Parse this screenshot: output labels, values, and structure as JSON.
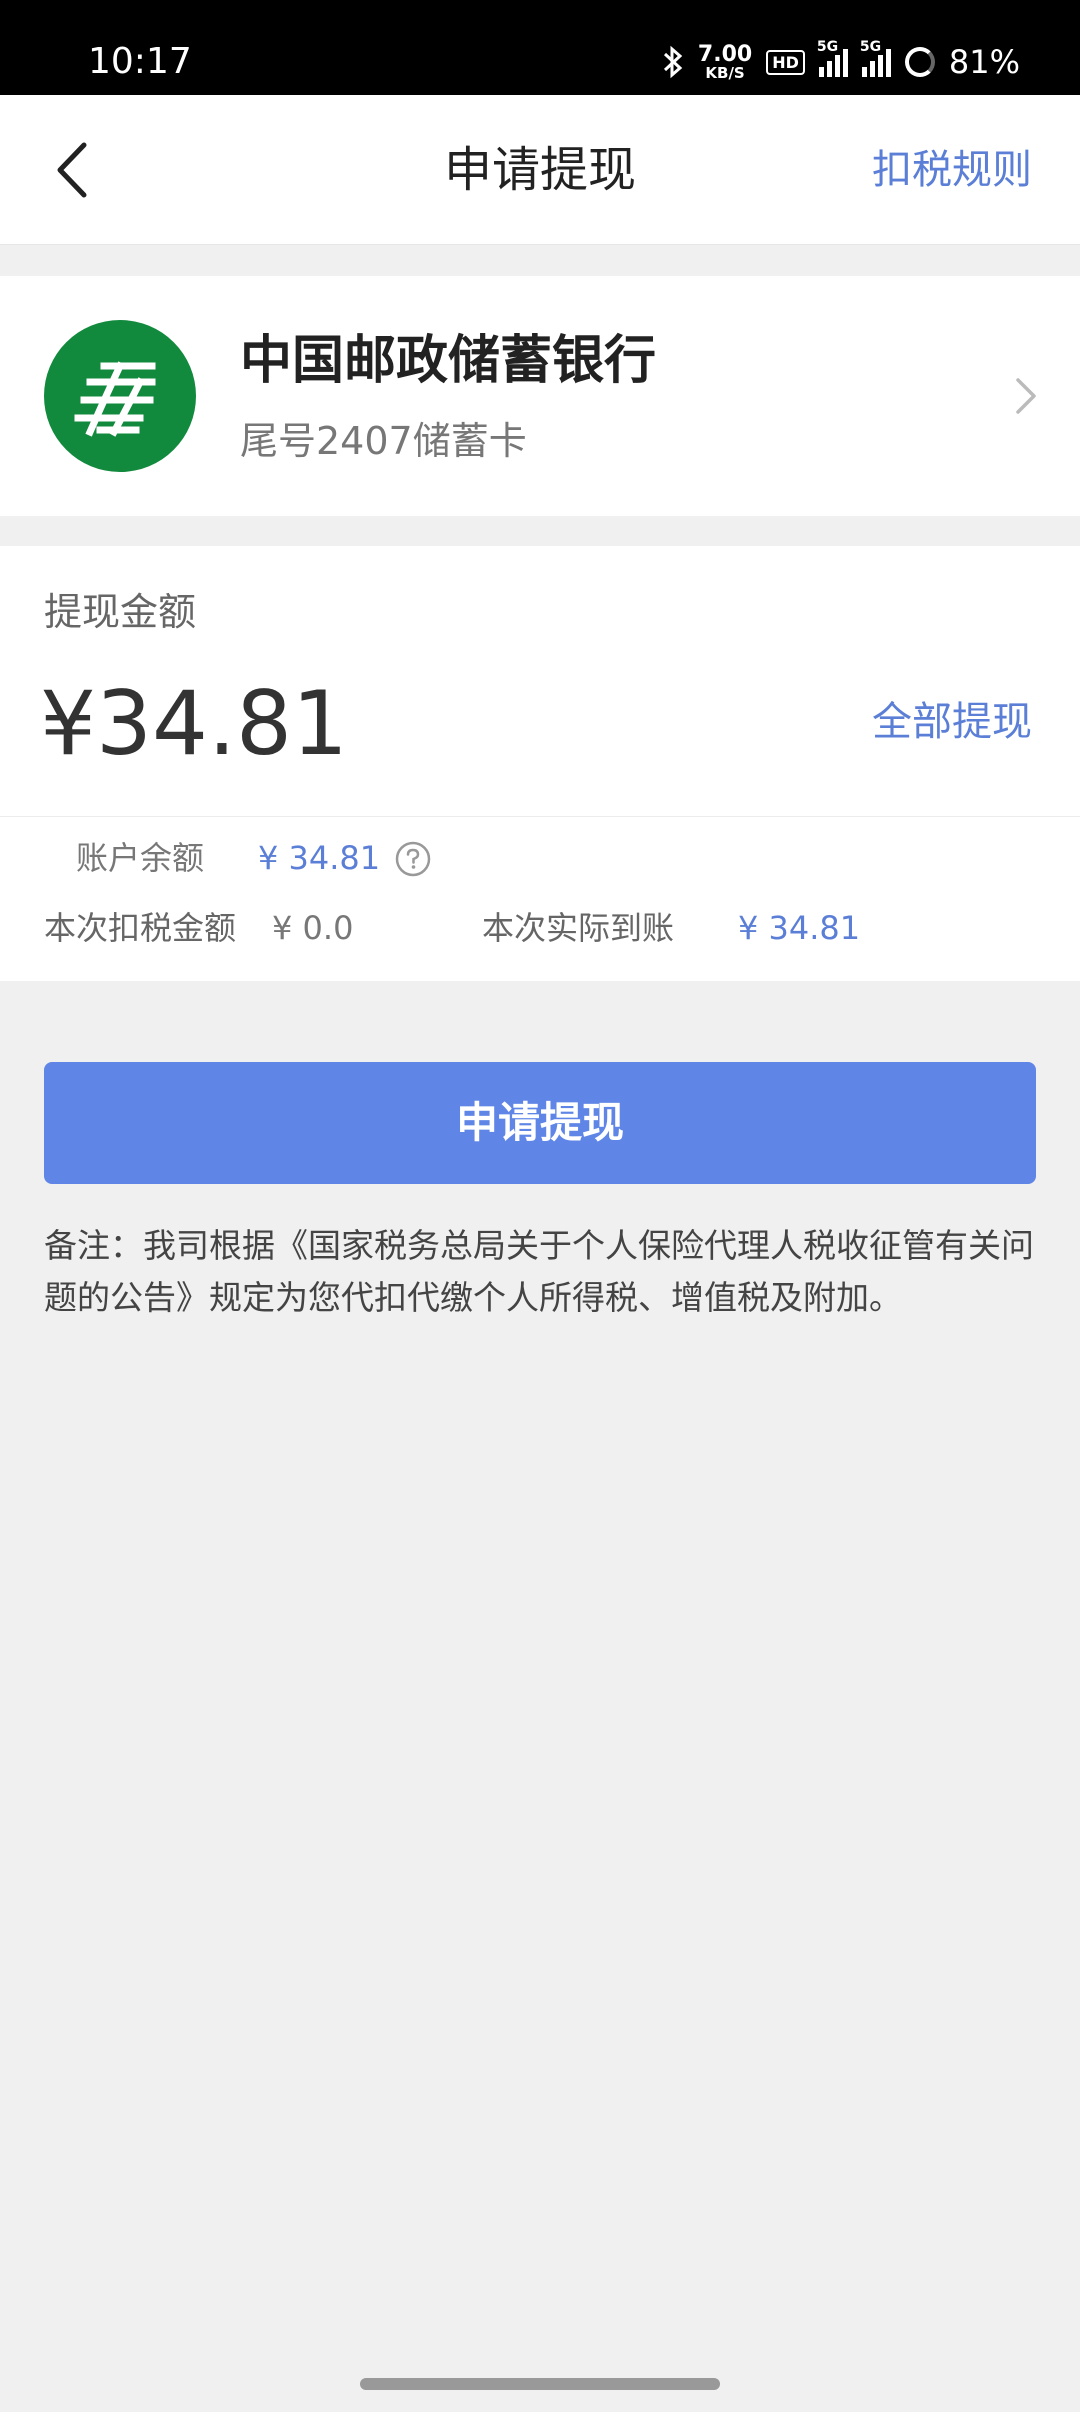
{
  "status_bar": {
    "time": "10:17",
    "net_speed_value": "7.00",
    "net_speed_unit": "KB/S",
    "hd_badge": "HD",
    "signal1_label": "5G",
    "signal2_label": "5G",
    "battery": "81%"
  },
  "header": {
    "title": "申请提现",
    "tax_rule_link": "扣税规则",
    "back_icon": "chevron-left-icon"
  },
  "bank_card": {
    "bank_name": "中国邮政储蓄银行",
    "card_tail": "尾号2407储蓄卡",
    "logo_color": "#128a3d",
    "chevron_icon": "chevron-right-icon"
  },
  "withdraw": {
    "amount_label": "提现金额",
    "amount_value": "¥34.81",
    "withdraw_all_label": "全部提现",
    "balance_label": "账户余额",
    "balance_value": "¥ 34.81",
    "tax_label": "本次扣税金额",
    "tax_value": "¥ 0.0",
    "actual_label": "本次实际到账",
    "actual_value": "¥ 34.81"
  },
  "submit_button": {
    "label": "申请提现",
    "color": "#5f86e6"
  },
  "remark": "备注：我司根据《国家税务总局关于个人保险代理人税收征管有关问题的公告》规定为您代扣代缴个人所得税、增值税及附加。",
  "colors": {
    "accent": "#5b7fd6",
    "background": "#f0f0f0"
  }
}
